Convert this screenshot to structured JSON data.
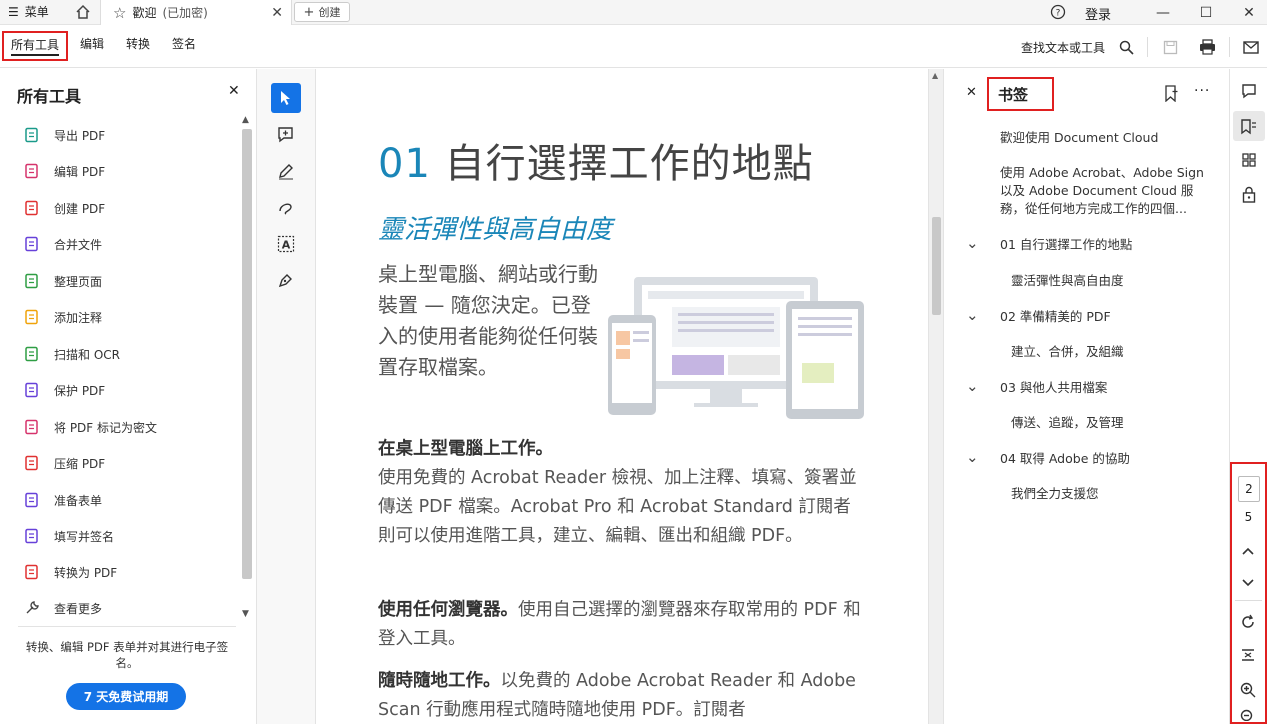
{
  "titlebar": {
    "menu_label": "菜单",
    "tab_title": "歡迎",
    "tab_status": "(已加密)",
    "new_tab_label": "创建",
    "login_label": "登录"
  },
  "toolbar": {
    "tabs": [
      "所有工具",
      "编辑",
      "转换",
      "签名"
    ],
    "find_label": "查找文本或工具"
  },
  "left_panel": {
    "title": "所有工具",
    "tools": [
      {
        "label": "导出 PDF",
        "color": "#1a9a8a"
      },
      {
        "label": "编辑 PDF",
        "color": "#d6336c"
      },
      {
        "label": "创建 PDF",
        "color": "#e03131"
      },
      {
        "label": "合并文件",
        "color": "#6741d9"
      },
      {
        "label": "整理页面",
        "color": "#2f9e44"
      },
      {
        "label": "添加注释",
        "color": "#f0a30a"
      },
      {
        "label": "扫描和 OCR",
        "color": "#2f9e44"
      },
      {
        "label": "保护 PDF",
        "color": "#6741d9"
      },
      {
        "label": "将 PDF 标记为密文",
        "color": "#d6336c"
      },
      {
        "label": "压缩 PDF",
        "color": "#e03131"
      },
      {
        "label": "准备表单",
        "color": "#6741d9"
      },
      {
        "label": "填写并签名",
        "color": "#6741d9"
      },
      {
        "label": "转换为 PDF",
        "color": "#e03131"
      }
    ],
    "see_more": "查看更多",
    "promo_text": "转换、编辑 PDF 表单并对其进行电子签名。",
    "trial_button": "7 天免费试用期"
  },
  "document": {
    "title_num": "01",
    "title_text": "自行選擇工作的地點",
    "subtitle": "靈活彈性與高自由度",
    "intro": "桌上型電腦、網站或行動裝置 — 隨您決定。已登入的使用者能夠從任何裝置存取檔案。",
    "p1_head": "在桌上型電腦上工作。",
    "p1_body": "使用免費的 Acrobat Reader 檢視、加上注釋、填寫、簽署並傳送 PDF 檔案。Acrobat Pro 和 Acrobat Standard 訂閱者則可以使用進階工具，建立、編輯、匯出和組織 PDF。",
    "p2_head": "使用任何瀏覽器。",
    "p2_body": "使用自己選擇的瀏覽器來存取常用的 PDF 和登入工具。",
    "p3_head": "隨時隨地工作。",
    "p3_body": "以免費的 Adobe Acrobat Reader 和 Adobe Scan 行動應用程式隨時隨地使用 PDF。訂閱者"
  },
  "bookmarks": {
    "title": "书签",
    "items": [
      {
        "label": "歡迎使用 Document Cloud",
        "level": 0,
        "expandable": false
      },
      {
        "label": "使用 Adobe Acrobat、Adobe Sign 以及 Adobe Document Cloud 服務，從任何地方完成工作的四個...",
        "level": 0,
        "expandable": false
      },
      {
        "label": "01 自行選擇工作的地點",
        "level": 0,
        "expandable": true
      },
      {
        "label": "靈活彈性與高自由度",
        "level": 1,
        "expandable": false
      },
      {
        "label": "02 準備精美的 PDF",
        "level": 0,
        "expandable": true
      },
      {
        "label": "建立、合併，及組織",
        "level": 1,
        "expandable": false
      },
      {
        "label": "03 與他人共用檔案",
        "level": 0,
        "expandable": true
      },
      {
        "label": "傳送、追蹤，及管理",
        "level": 1,
        "expandable": false
      },
      {
        "label": "04 取得 Adobe 的協助",
        "level": 0,
        "expandable": true
      },
      {
        "label": "我們全力支援您",
        "level": 1,
        "expandable": false
      }
    ]
  },
  "page_nav": {
    "current_page": "2",
    "total_pages": "5"
  },
  "colors": {
    "accent": "#1473e6",
    "highlight_red": "#e02020",
    "doc_blue": "#1a86b8"
  }
}
